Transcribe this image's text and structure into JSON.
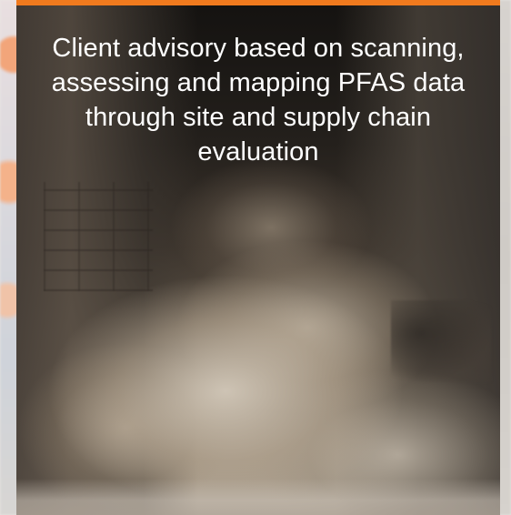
{
  "card": {
    "caption": "Client advisory based on scanning, assessing and mapping PFAS data through site and supply chain evaluation",
    "accent_color": "#f07a1e",
    "text_color": "#ffffff"
  },
  "background": {
    "image": "flood-water-photo"
  }
}
